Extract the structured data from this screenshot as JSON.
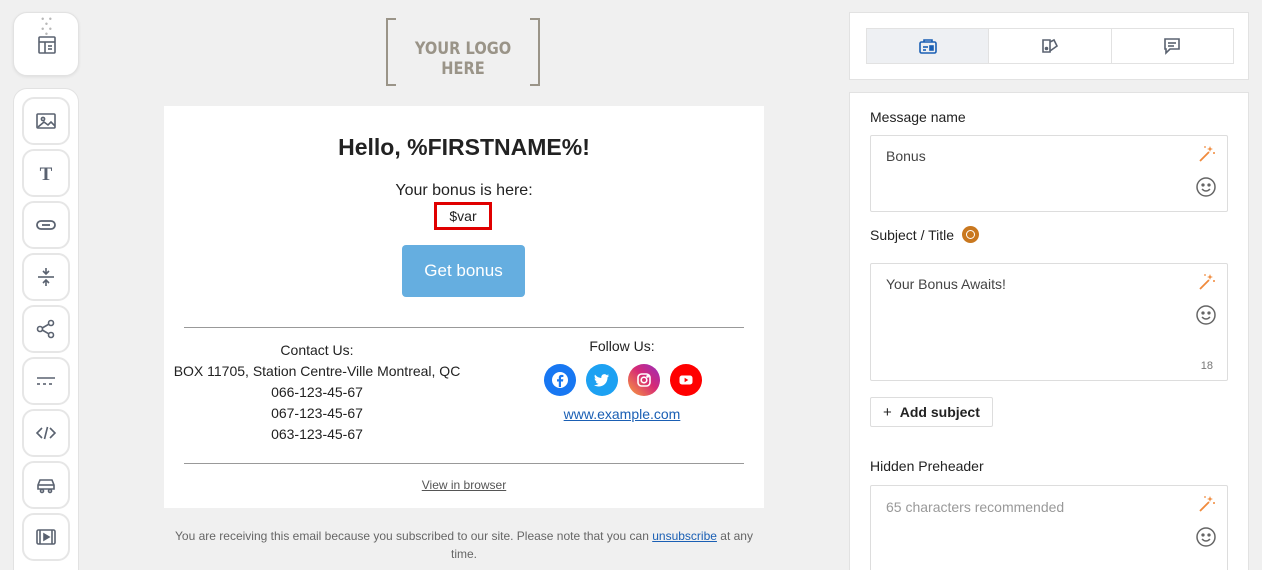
{
  "logo": {
    "text": "YOUR LOGO HERE"
  },
  "email": {
    "greeting": "Hello, %FIRSTNAME%!",
    "bonus_line": "Your bonus is here:",
    "variable": "$var",
    "cta_label": "Get bonus",
    "contact": {
      "title": "Contact Us:",
      "address": "BOX 11705, Station Centre-Ville Montreal, QC",
      "phones": [
        "066-123-45-67",
        "067-123-45-67",
        "063-123-45-67"
      ]
    },
    "follow": {
      "title": "Follow Us:",
      "networks": [
        {
          "icon": "facebook-icon",
          "color": "#1877f2"
        },
        {
          "icon": "twitter-icon",
          "color": "#1da1f2"
        },
        {
          "icon": "instagram-icon",
          "color": "#d62976"
        },
        {
          "icon": "youtube-icon",
          "color": "#ff0000"
        }
      ],
      "website": "www.example.com"
    },
    "view_in_browser": "View in browser",
    "footer": {
      "before": "You are receiving this email because you subscribed to our site. Please note that you can ",
      "link": "unsubscribe",
      "after": " at any time."
    }
  },
  "toolbar": {
    "drag_icon": "template-icon",
    "tools": [
      "image-icon",
      "text-icon",
      "button-icon",
      "spacer-icon",
      "social-icon",
      "divider-icon",
      "html-icon",
      "product-icon",
      "video-icon"
    ]
  },
  "panel": {
    "tabs": [
      {
        "icon": "message-settings-icon",
        "active": true
      },
      {
        "icon": "appearance-icon",
        "active": false
      },
      {
        "icon": "comments-icon",
        "active": false
      }
    ],
    "message_name": {
      "label": "Message name",
      "value": "Bonus"
    },
    "subject": {
      "label": "Subject / Title",
      "value": "Your Bonus Awaits!",
      "count": "18"
    },
    "add_subject": "Add subject",
    "preheader": {
      "label": "Hidden Preheader",
      "placeholder": "65 characters recommended"
    }
  },
  "colors": {
    "accent": "#65aee0",
    "highlight": "#e00000",
    "link": "#1a5fb4",
    "wand": "#f08a3c"
  }
}
